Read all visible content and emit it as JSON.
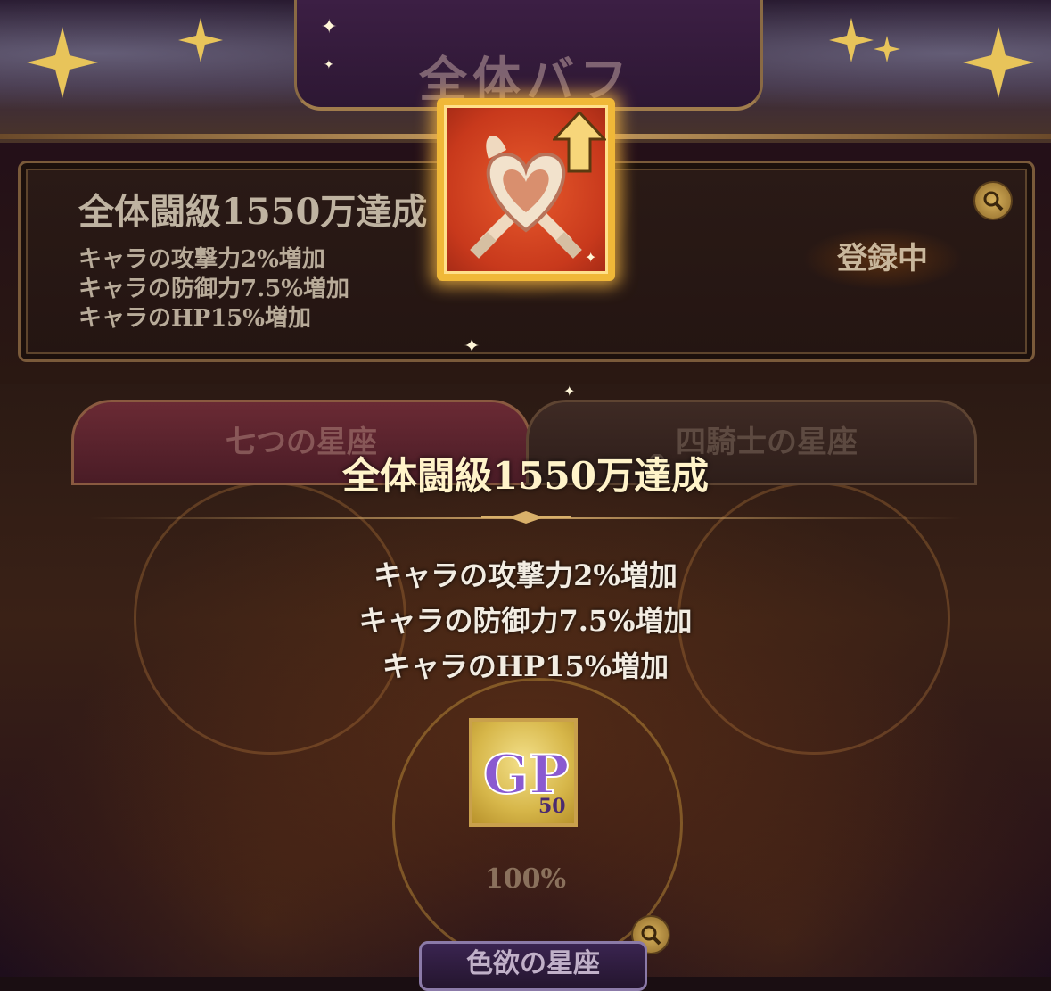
{
  "banner": {
    "title": "全体バフ"
  },
  "buff_card": {
    "title": "全体闘級1550万達成",
    "effects": [
      "キャラの攻撃力2%増加",
      "キャラの防御力7.5%増加",
      "キャラのHP15%増加"
    ],
    "status": "登録中",
    "detail_icon": "magnifier-icon"
  },
  "buff_icon": {
    "name": "heart-swords-buff-icon",
    "badge": "up-arrow-icon"
  },
  "tabs": [
    {
      "label": "七つの星座",
      "active": true
    },
    {
      "label": "四騎士の星座",
      "locked": true,
      "icon": "lock-icon"
    }
  ],
  "popup": {
    "title": "全体闘級1550万達成",
    "effects": [
      "キャラの攻撃力2%増加",
      "キャラの防御力7.5%増加",
      "キャラのHP15%増加"
    ],
    "reward": {
      "letters": "GP",
      "amount": "50"
    }
  },
  "constellation": {
    "progress": "100%",
    "name": "色欲の星座",
    "detail_icon": "magnifier-icon"
  },
  "colors": {
    "title_gold": "#fff3c9",
    "frame_gold": "#c9a062",
    "icon_red": "#c8391c",
    "icon_border": "#f0b838"
  }
}
